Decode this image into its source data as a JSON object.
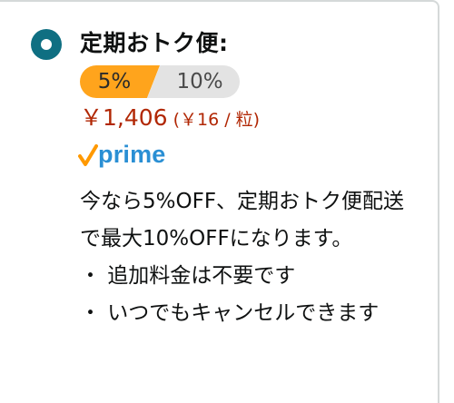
{
  "option": {
    "title": "定期おトク便:",
    "selected": true,
    "tiers": [
      {
        "label": "5%",
        "active": true
      },
      {
        "label": "10%",
        "active": false
      }
    ],
    "price": "￥1,406",
    "unit_price": "(￥16 / 粒)",
    "prime_label": "prime",
    "description": "今なら5%OFF、定期おトク便配送で最大10%OFFになります。",
    "bullets": [
      "・ 追加料金は不要です",
      "・ いつでもキャンセルできます"
    ]
  },
  "colors": {
    "radio": "#0f6f82",
    "active_tier": "#ffa41c",
    "inactive_tier": "#e3e3e3",
    "price": "#b12704",
    "prime_blue": "#2a8fd4",
    "prime_check": "#ff9900"
  }
}
